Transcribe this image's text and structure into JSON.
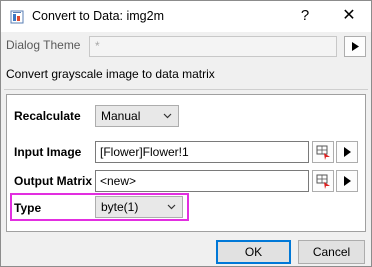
{
  "window": {
    "title": "Convert to Data: img2m",
    "help_glyph": "?",
    "close_glyph": "✕"
  },
  "theme": {
    "label": "Dialog Theme",
    "value": "*"
  },
  "description": "Convert grayscale image to data matrix",
  "fields": {
    "recalculate": {
      "label": "Recalculate",
      "value": "Manual"
    },
    "input_image": {
      "label": "Input Image",
      "value": "[Flower]Flower!1"
    },
    "output_matrix": {
      "label": "Output Matrix",
      "value": "<new>"
    },
    "type": {
      "label": "Type",
      "value": "byte(1)"
    }
  },
  "buttons": {
    "ok": "OK",
    "cancel": "Cancel"
  },
  "colors": {
    "highlight": "#e22ee0",
    "accent": "#0078d7"
  }
}
